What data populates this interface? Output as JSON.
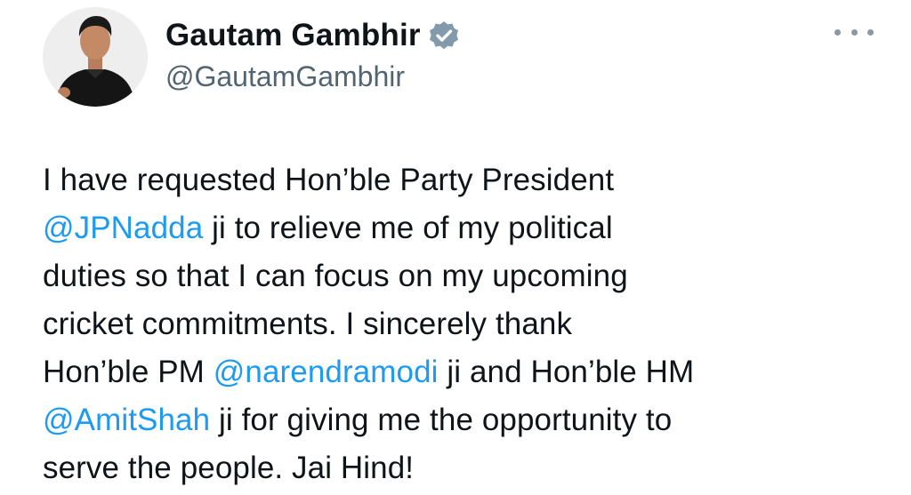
{
  "author": {
    "display_name": "Gautam Gambhir",
    "handle": "@GautamGambhir",
    "verified_icon": "verified-badge-icon",
    "avatar": "profile-photo"
  },
  "more_menu": {
    "icon": "more-options-icon"
  },
  "tweet": {
    "lines": [
      {
        "before": "I have requested Hon’ble Party President",
        "mention": "",
        "after": ""
      },
      {
        "before": "",
        "mention": "@JPNadda",
        "after": " ji to relieve me of my political"
      },
      {
        "before": "duties so that I can focus on my upcoming",
        "mention": "",
        "after": ""
      },
      {
        "before": "cricket commitments. I sincerely thank",
        "mention": "",
        "after": ""
      },
      {
        "before": "Hon’ble PM ",
        "mention": "@narendramodi",
        "after": " ji and Hon’ble HM"
      },
      {
        "before": "",
        "mention": "@AmitShah",
        "after": " ji for giving me the opportunity to"
      },
      {
        "before": "serve the people. Jai Hind!",
        "mention": "",
        "after": ""
      }
    ]
  },
  "colors": {
    "mention": "#1d9bf0",
    "handle": "#536471",
    "text": "#0f1419",
    "verified_badge": "#829aab"
  }
}
